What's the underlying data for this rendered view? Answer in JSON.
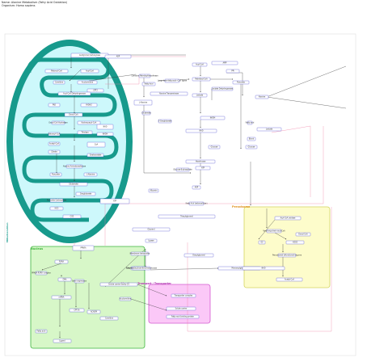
{
  "header": {
    "title": "Name: Alanine Metabolism (Fatty Acid Oxidation)",
    "organism": "Organism: Homo sapiens"
  },
  "regions": {
    "mitochondrion": "Mitochondrion",
    "nucleus": "Nucleus",
    "peroxisome": "Peroxisome",
    "membrane_transport": "Membrane Transport / Transporter"
  },
  "colors": {
    "mito_outer": "#179a8c",
    "mito_matrix": "#cdf8fb",
    "nucleus_fill": "#d7f7c8",
    "nucleus_border": "#3cb53c",
    "perox_fill": "#fdfccb",
    "perox_border": "#d4d460",
    "magenta_fill": "#fbc8f7",
    "magenta_border": "#d45bd0",
    "node_border": "#4848d0",
    "edge": "#333333",
    "pink_edge": "#f07aa0"
  },
  "nodes": {
    "mito_top": "Acetyl-CoA Carboxylase",
    "mito_a": "Malonyl-CoA",
    "mito_b": "Acyl-CoA",
    "mito_c": "Carnitine",
    "mito_d": "Acylcarnitine",
    "mito_e": "CPT2",
    "mito_f": "Acyl-CoA Dehydrogenase",
    "mito_g": "FAD",
    "mito_h": "FADH2",
    "mito_i": "Enoyl-CoA",
    "mito_j": "Enoyl-CoA Hydratase",
    "mito_k": "Hydroxyacyl-CoA",
    "mito_l": "NAD",
    "mito_m": "NADH",
    "mito_n": "Ketoacyl-CoA",
    "mito_o": "Thiolase",
    "mito_p": "Acetyl-CoA",
    "mito_q": "CoA",
    "mito_r": "Citrate",
    "mito_s": "Oxaloacetate",
    "mito_t": "Alanine Aminotransferase",
    "mito_u": "Pyruvate",
    "mito_v": "L-Alanine",
    "mito_w": "Glutamate",
    "mito_x": "Oxoglutarate",
    "mito_y": "Pyruvate Carboxylase",
    "mito_z": "H2O",
    "mito_aa": "CO2",
    "mito_ab": "ATP",
    "mito_ac": "ADP",
    "cyto_1": "Carnitine Palmitoyltransferase",
    "cyto_2": "Fatty Acid",
    "cyto_3": "Long-chain-fatty-acid--CoA ligase",
    "cyto_4": "Palmitoyl-CoA",
    "cyto_5": "Acyl-CoA",
    "cyto_6": "AMP",
    "cyto_7": "PPi",
    "cyto_8": "Pyruvate",
    "cyto_9": "L-Alanine",
    "cyto_10": "Alanine Transaminase",
    "cyto_11": "Glutamate",
    "cyto_12": "2-Oxoglutarate",
    "cyto_13": "Lactate",
    "cyto_14": "Lactate Dehydrogenase",
    "cyto_15": "NADH",
    "cyto_16": "NAD",
    "cyto_17": "Glucose",
    "cyto_18": "Hexokinase",
    "cyto_19": "Glucose-6-phosphate",
    "cyto_20": "ATP",
    "cyto_21": "ADP",
    "cyto_22": "Triacylglycerol",
    "cyto_23": "Glycerol",
    "cyto_24": "Lipase",
    "cyto_25": "Diacylglycerol",
    "cyto_26": "Monoacylglycerol",
    "cyto_27": "Fatty acid transport protein",
    "cyto_28": "Albumin",
    "cyto_29": "Fatty Acid (extracellular)",
    "right_1": "Alanine",
    "right_2": "Fatty acid",
    "right_3": "Lactate",
    "right_4": "Blood",
    "right_5": "Glucose",
    "perox_1": "Acyl-CoA oxidase",
    "perox_2": "Very-long-chain acyl-CoA",
    "perox_3": "O2",
    "perox_4": "H2O2",
    "perox_5": "Enoyl-CoA",
    "perox_6": "Peroxisomal bifunctional enzyme",
    "perox_7": "Acetyl-CoA",
    "perox_8": "NAD",
    "nuc_1": "PPARA",
    "nuc_2": "RXRA",
    "nuc_3": "PPARA:RXRA complex",
    "nuc_4": "DNA",
    "nuc_5": "Gene expression",
    "nuc_6": "mRNA",
    "nuc_7": "CPT1A",
    "nuc_8": "ACADM",
    "nuc_9": "Fatty acid",
    "nuc_10": "Ligand",
    "mid_1": "Membrane transporter",
    "mid_2": "Carnitine/acylcarnitine translocase",
    "mid_3": "Solute carrier family 25",
    "mid_4": "Acylcarnitine",
    "mid_5": "Carnitine",
    "mag_1": "Transporter complex",
    "mag_2": "Solute carrier",
    "mag_3": "Fatty acid binding protein"
  }
}
